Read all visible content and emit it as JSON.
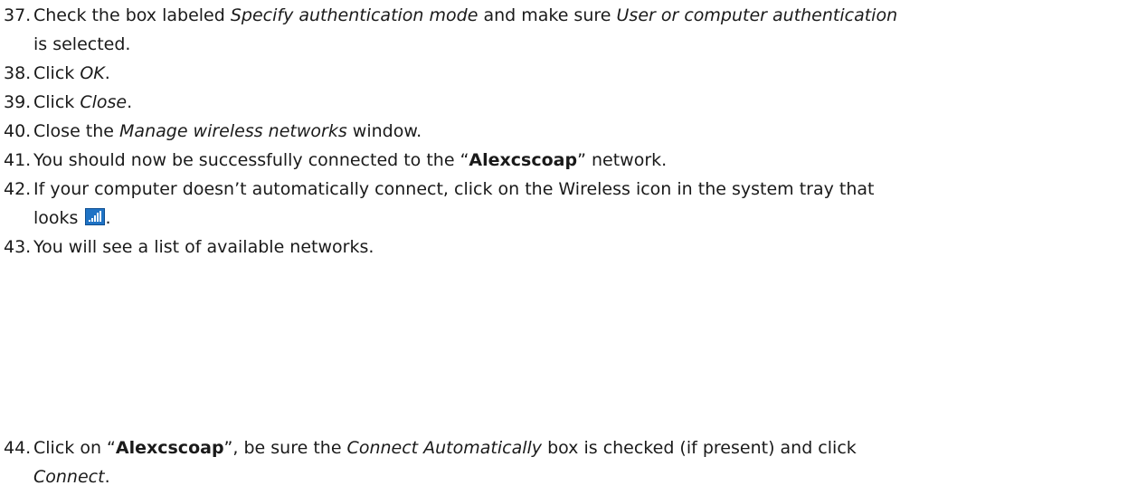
{
  "steps": [
    {
      "number": "37.",
      "p1": "Check the box labeled ",
      "i1": "Specify authentication mode",
      "p2": " and make sure ",
      "i2": "User or computer authentication",
      "line2": "is selected."
    },
    {
      "number": "38.",
      "p1": "Click ",
      "i1": "OK",
      "p2": "."
    },
    {
      "number": "39.",
      "p1": "Click ",
      "i1": "Close",
      "p2": "."
    },
    {
      "number": "40.",
      "p1": "Close the ",
      "i1": "Manage wireless networks",
      "p2": " window."
    },
    {
      "number": "41.",
      "p1": "You should now be successfully connected to the “",
      "b1": "Alexcscoap",
      "p2": "” network."
    },
    {
      "number": "42.",
      "p1": "If your computer doesn’t automatically connect, click on the Wireless icon in the system tray that",
      "line2": "looks",
      "icon": "wireless-signal-icon",
      "line2_end": "."
    },
    {
      "number": "43.",
      "p1": "You will see a list of available networks."
    },
    {
      "number": "44.",
      "p1": "Click on “",
      "b1": "Alexcscoap",
      "p2": "”, be sure the ",
      "i1": "Connect Automatically",
      "p3": " box is checked (if present) and click",
      "line2_i": "Connect",
      "line2_end": "."
    }
  ],
  "colors": {
    "text": "#1a1a1a",
    "icon_background": "#1f73c5"
  }
}
